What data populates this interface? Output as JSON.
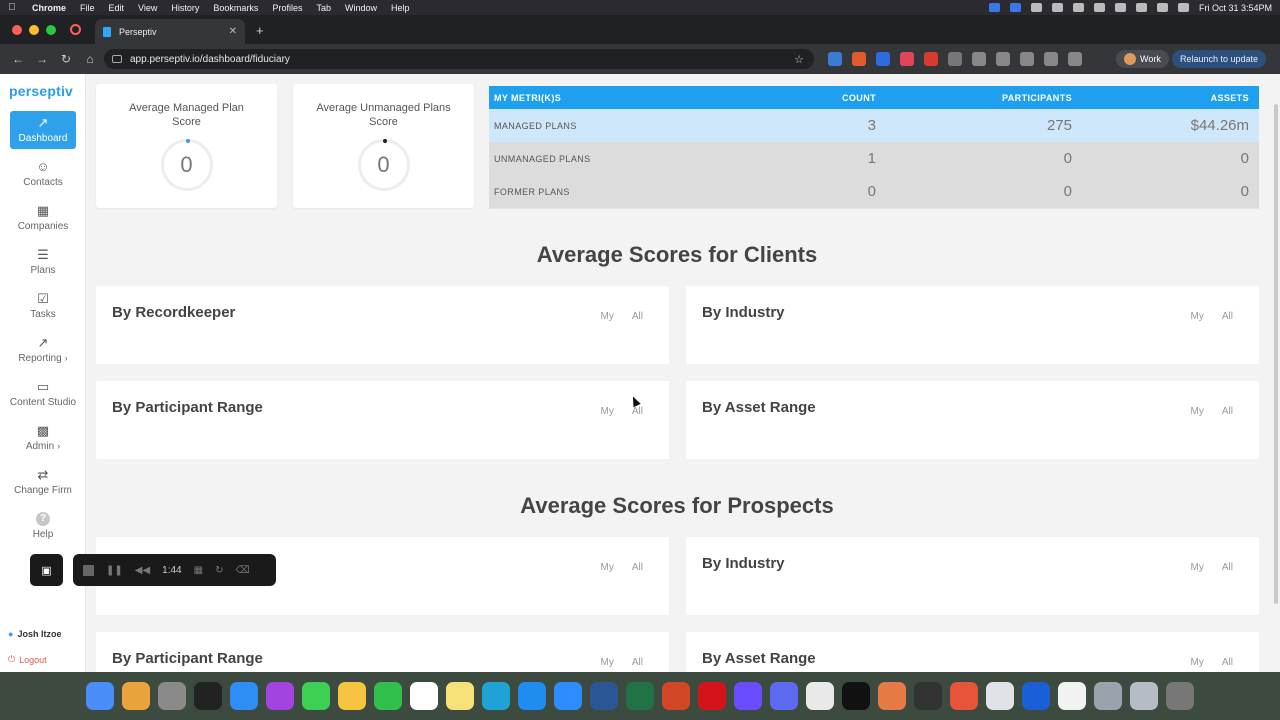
{
  "menubar": {
    "app_name": "Chrome",
    "items": [
      "File",
      "Edit",
      "View",
      "History",
      "Bookmarks",
      "Profiles",
      "Tab",
      "Window",
      "Help"
    ],
    "clock": "Fri Oct 31  3:54PM"
  },
  "browser": {
    "tab_title": "Perseptiv",
    "url": "app.perseptiv.io/dashboard/fiduciary",
    "profile_label": "Work",
    "relaunch_label": "Relaunch to update"
  },
  "sidebar": {
    "logo": "perseptiv",
    "items": [
      {
        "label": "Dashboard",
        "icon": "chart-line-icon"
      },
      {
        "label": "Contacts",
        "icon": "person-icon"
      },
      {
        "label": "Companies",
        "icon": "building-icon"
      },
      {
        "label": "Plans",
        "icon": "list-icon"
      },
      {
        "label": "Tasks",
        "icon": "checklist-icon"
      },
      {
        "label": "Reporting",
        "icon": "trend-icon"
      },
      {
        "label": "Content Studio",
        "icon": "monitor-icon"
      },
      {
        "label": "Admin",
        "icon": "folder-gear-icon"
      },
      {
        "label": "Change Firm",
        "icon": "swap-arrows-icon"
      },
      {
        "label": "Help",
        "icon": "question-icon"
      }
    ],
    "user_name": "Josh Itzoe",
    "logout_label": "Logout"
  },
  "score_cards": [
    {
      "title": "Average Managed Plan Score",
      "value": "0",
      "dot_color": "#2fa1ea"
    },
    {
      "title": "Average Unmanaged Plans Score",
      "value": "0",
      "dot_color": "#222222"
    }
  ],
  "metrics": {
    "headers": [
      "MY METRI(K)S",
      "COUNT",
      "PARTICIPANTS",
      "ASSETS"
    ],
    "rows": [
      {
        "label": "MANAGED PLANS",
        "count": "3",
        "participants": "275",
        "assets": "$44.26m"
      },
      {
        "label": "UNMANAGED PLANS",
        "count": "1",
        "participants": "0",
        "assets": "0"
      },
      {
        "label": "FORMER PLANS",
        "count": "0",
        "participants": "0",
        "assets": "0"
      }
    ]
  },
  "clients_section": {
    "title": "Average Scores for Clients",
    "panels": [
      "By Recordkeeper",
      "By Industry",
      "By Participant Range",
      "By Asset Range"
    ]
  },
  "prospects_section": {
    "title": "Average Scores for Prospects",
    "panels": [
      "",
      "By Industry",
      "By Participant Range",
      "By Asset Range"
    ]
  },
  "toggle": {
    "my": "My",
    "all": "All"
  },
  "recording": {
    "time": "1:44"
  },
  "colors": {
    "accent": "#2fa1ea",
    "header_blue": "#1ea0ef",
    "highlight_row": "#cfe7fb"
  }
}
